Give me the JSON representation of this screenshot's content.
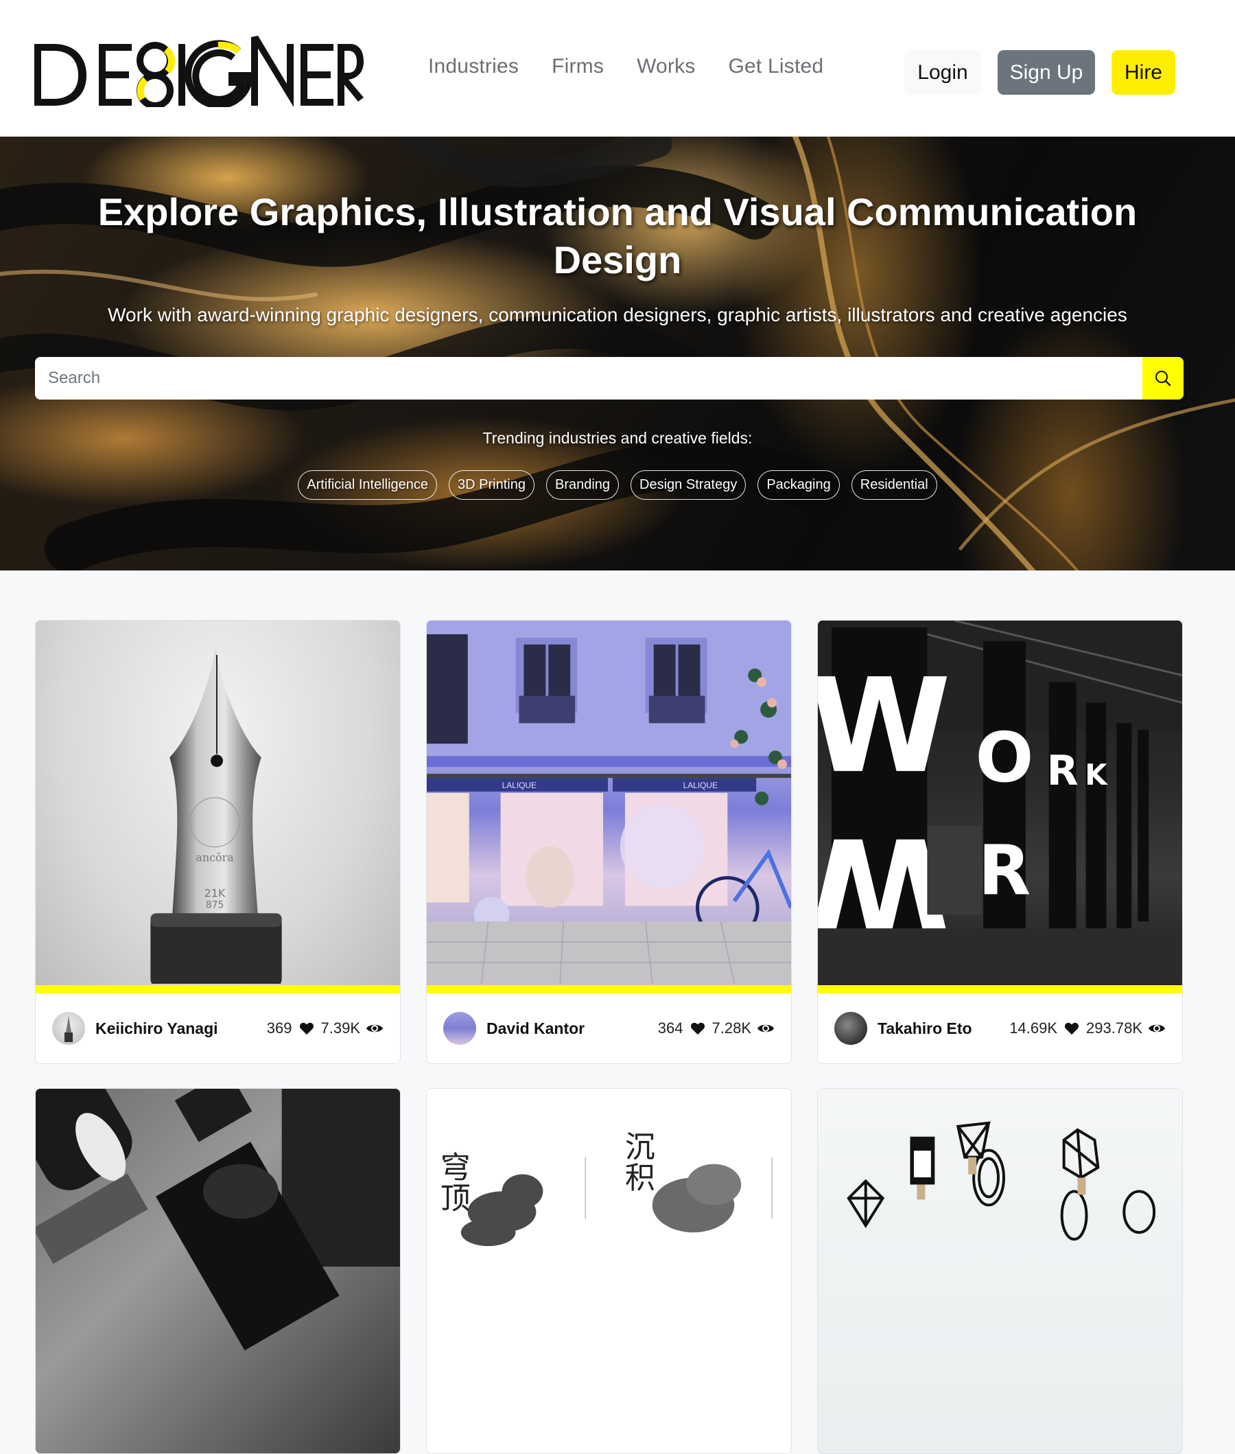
{
  "header": {
    "logo_text": "DESIGNER",
    "nav": [
      {
        "label": "Industries"
      },
      {
        "label": "Firms"
      },
      {
        "label": "Works"
      },
      {
        "label": "Get Listed"
      }
    ],
    "buttons": {
      "login": "Login",
      "signup": "Sign Up",
      "hire": "Hire"
    }
  },
  "hero": {
    "title": "Explore Graphics, Illustration and Visual Communication Design",
    "subtitle": "Work with award-winning graphic designers, communication designers, graphic artists, illustrators and creative agencies",
    "search": {
      "placeholder": "Search",
      "value": "",
      "button_icon": "search-icon"
    },
    "trending_label": "Trending industries and creative fields:",
    "chips": [
      {
        "label": "Artificial Intelligence"
      },
      {
        "label": "3D Printing"
      },
      {
        "label": "Branding"
      },
      {
        "label": "Design Strategy"
      },
      {
        "label": "Packaging"
      },
      {
        "label": "Residential"
      }
    ]
  },
  "cards": [
    {
      "author": "Keiichiro Yanagi",
      "likes": "369",
      "views": "7.39K",
      "image": "fountain-pen-nib",
      "image_text": [
        "ancōra",
        "21K",
        "875"
      ]
    },
    {
      "author": "David Kantor",
      "likes": "364",
      "views": "7.28K",
      "image": "lalique-storefront",
      "image_text": [
        "LALIQUE",
        "LALIQUE"
      ]
    },
    {
      "author": "Takahiro Eto",
      "likes": "14.69K",
      "views": "293.78K",
      "image": "workout-gym-typography",
      "image_text": [
        "W",
        "O",
        "R",
        "K"
      ]
    },
    {
      "author": "",
      "likes": "",
      "views": "",
      "image": "coffee-packaging"
    },
    {
      "author": "",
      "likes": "",
      "views": "",
      "image": "chinese-poster-illustration"
    },
    {
      "author": "",
      "likes": "",
      "views": "",
      "image": "geometric-wire-sculptures"
    }
  ],
  "colors": {
    "accent_yellow": "#ffff00",
    "hire_yellow": "#ffee00",
    "signup_gray": "#6c757d",
    "login_bg": "#f8f9fa",
    "nav_text": "#6c6f73",
    "page_bg": "#f7f8fa"
  }
}
